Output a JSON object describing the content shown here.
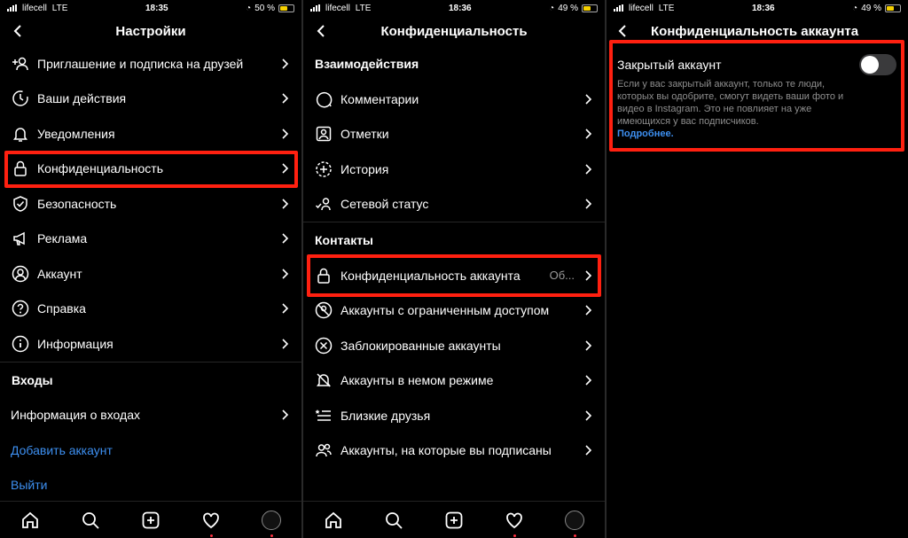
{
  "status_bars": [
    {
      "carrier": "lifecell",
      "network": "LTE",
      "time": "18:35",
      "battery": "50 %"
    },
    {
      "carrier": "lifecell",
      "network": "LTE",
      "time": "18:36",
      "battery": "49 %"
    },
    {
      "carrier": "lifecell",
      "network": "LTE",
      "time": "18:36",
      "battery": "49 %"
    }
  ],
  "screen1": {
    "title": "Настройки",
    "items": [
      {
        "label": "Приглашение и подписка на друзей",
        "icon": "add-person-icon"
      },
      {
        "label": "Ваши действия",
        "icon": "activity-clock-icon"
      },
      {
        "label": "Уведомления",
        "icon": "bell-icon"
      },
      {
        "label": "Конфиденциальность",
        "icon": "lock-icon"
      },
      {
        "label": "Безопасность",
        "icon": "shield-icon"
      },
      {
        "label": "Реклама",
        "icon": "megaphone-icon"
      },
      {
        "label": "Аккаунт",
        "icon": "account-circle-icon"
      },
      {
        "label": "Справка",
        "icon": "help-icon"
      },
      {
        "label": "Информация",
        "icon": "info-icon"
      }
    ],
    "logins_header": "Входы",
    "login_info": "Информация о входах",
    "add_account": "Добавить аккаунт",
    "logout": "Выйти"
  },
  "screen2": {
    "title": "Конфиденциальность",
    "interactions_header": "Взаимодействия",
    "interactions": [
      {
        "label": "Комментарии",
        "icon": "comment-icon"
      },
      {
        "label": "Отметки",
        "icon": "tag-person-icon"
      },
      {
        "label": "История",
        "icon": "story-plus-icon"
      },
      {
        "label": "Сетевой статус",
        "icon": "activity-status-icon"
      }
    ],
    "contacts_header": "Контакты",
    "contacts": [
      {
        "label": "Конфиденциальность аккаунта",
        "value": "Об...",
        "icon": "lock-icon"
      },
      {
        "label": "Аккаунты с ограниченным доступом",
        "icon": "restricted-icon"
      },
      {
        "label": "Заблокированные аккаунты",
        "icon": "blocked-icon"
      },
      {
        "label": "Аккаунты в немом режиме",
        "icon": "muted-bell-icon"
      },
      {
        "label": "Близкие друзья",
        "icon": "close-friends-list-icon"
      },
      {
        "label": "Аккаунты, на которые вы подписаны",
        "icon": "following-icon"
      }
    ]
  },
  "screen3": {
    "title": "Конфиденциальность аккаунта",
    "private_label": "Закрытый аккаунт",
    "private_enabled": false,
    "description": "Если у вас закрытый аккаунт, только те люди, которых вы одобрите, смогут видеть ваши фото и видео в Instagram. Это не повлияет на уже имеющихся у вас подписчиков.",
    "learn_more": "Подробнее."
  },
  "colors": {
    "highlight": "#ff2010",
    "link": "#3d8ff0",
    "background": "#000000"
  }
}
